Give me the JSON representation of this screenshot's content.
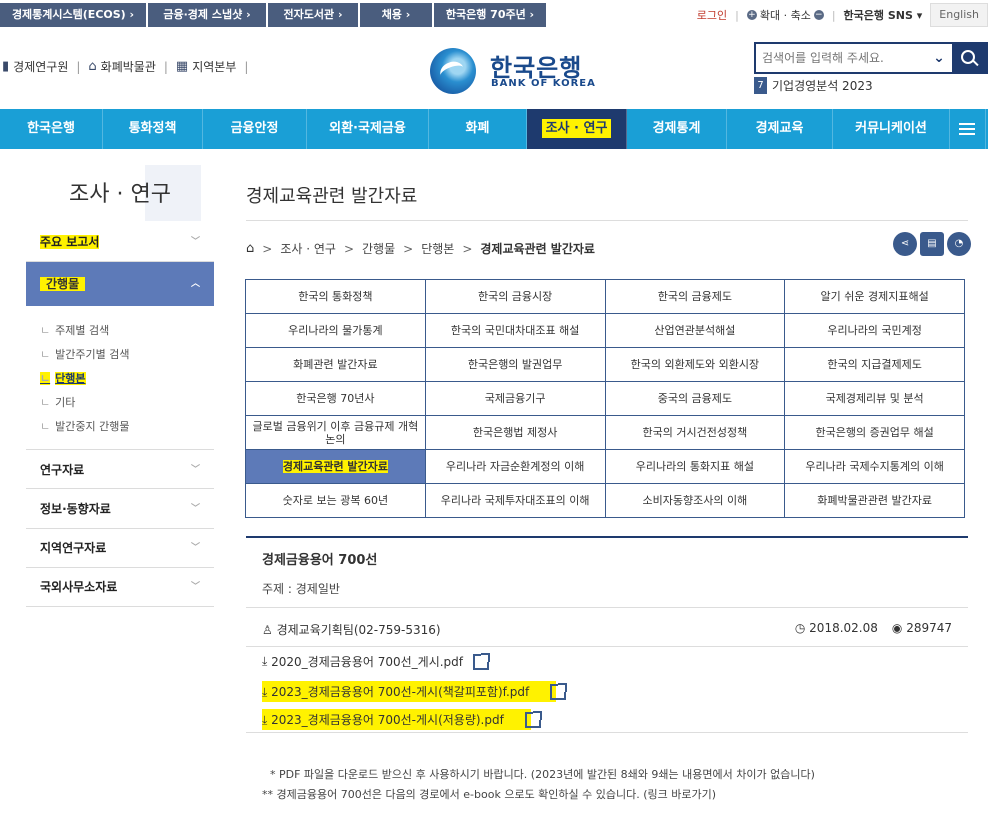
{
  "top_links": [
    "경제통계시스템(ECOS) ›",
    "금융·경제 스냅샷 ›",
    "전자도서관 ›",
    "채용 ›",
    "한국은행 70주년 ›"
  ],
  "top_right": {
    "login": "로그인",
    "zoom_label": "확대 · 축소",
    "sns": "한국은행 SNS ▾",
    "english": "English"
  },
  "header_links": [
    {
      "icon": "book-icon",
      "label": "경제연구원"
    },
    {
      "icon": "museum-icon",
      "label": "화폐박물관"
    },
    {
      "icon": "region-icon",
      "label": "지역본부"
    }
  ],
  "logo": {
    "ko": "한국은행",
    "en": "BANK OF KOREA"
  },
  "search": {
    "placeholder": "검색어를 입력해 주세요."
  },
  "popular": {
    "rank": "7",
    "text": "기업경영분석 2023"
  },
  "nav": [
    "한국은행",
    "통화정책",
    "금융안정",
    "외환·국제금융",
    "화폐",
    "조사 · 연구",
    "경제통계",
    "경제교육",
    "커뮤니케이션"
  ],
  "sidebar": {
    "title": "조사 · 연구",
    "sections": [
      "주요 보고서",
      "간행물",
      "연구자료",
      "정보·동향자료",
      "지역연구자료",
      "국외사무소자료"
    ],
    "sub_items": [
      "주제별 검색",
      "발간주기별 검색",
      "단행본",
      "기타",
      "발간중지 간행물"
    ]
  },
  "page": {
    "title": "경제교육관련 발간자료",
    "breadcrumb": [
      "조사 · 연구",
      "간행물",
      "단행본",
      "경제교육관련 발간자료"
    ]
  },
  "grid": [
    [
      "한국의 통화정책",
      "한국의 금융시장",
      "한국의 금융제도",
      "알기 쉬운 경제지표해설"
    ],
    [
      "우리나라의 물가통계",
      "한국의 국민대차대조표 해설",
      "산업연관분석해설",
      "우리나라의 국민계정"
    ],
    [
      "화폐관련 발간자료",
      "한국은행의 발권업무",
      "한국의 외환제도와 외환시장",
      "한국의 지급결제제도"
    ],
    [
      "한국은행 70년사",
      "국제금융기구",
      "중국의 금융제도",
      "국제경제리뷰 및 분석"
    ],
    [
      "글로벌 금융위기 이후 금융규제 개혁 논의",
      "한국은행법 제정사",
      "한국의 거시건전성정책",
      "한국은행의 증권업무 해설"
    ],
    [
      "경제교육관련 발간자료",
      "우리나라 자금순환계정의 이해",
      "우리나라의 통화지표 해설",
      "우리나라 국제수지통계의 이해"
    ],
    [
      "숫자로 보는 광복 60년",
      "우리나라 국제투자대조표의 이해",
      "소비자동향조사의 이해",
      "화폐박물관관련 발간자료"
    ]
  ],
  "detail": {
    "title": "경제금융용어 700선",
    "subject": "주제 : 경제일반",
    "author": "경제교육기획팀(02-759-5316)",
    "date": "2018.02.08",
    "views": "289747",
    "files": [
      "2020_경제금융용어 700선_게시.pdf",
      "2023_경제금융용어 700선-게시(책갈피포함)f.pdf",
      "2023_경제금융용어 700선-게시(저용량).pdf"
    ],
    "notes": [
      "* PDF 파일을 다운로드 받으신 후 사용하시기 바랍니다. (2023년에 발간된 8쇄와 9쇄는 내용면에서 차이가 없습니다)",
      "** 경제금융용어 700선은 다음의 경로에서 e-book 으로도 확인하실 수 있습니다. (링크 바로가기)"
    ]
  }
}
